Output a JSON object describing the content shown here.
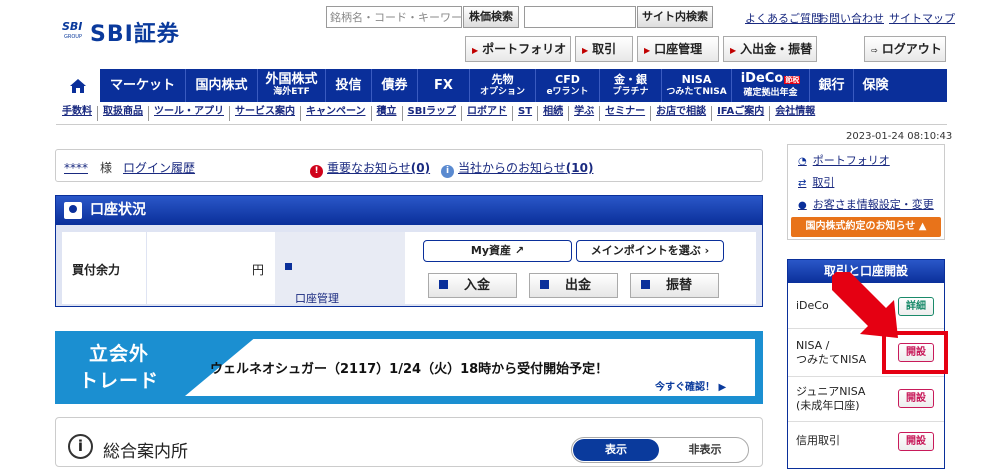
{
  "header": {
    "logo_mark": "SBI",
    "logo_group": "GROUP",
    "logo_text": "SBI証券",
    "stock_search_placeholder": "銘柄名・コード・キーワード",
    "stock_search_button": "株価検索",
    "site_search_value": "",
    "site_search_button": "サイト内検索",
    "links": [
      "よくあるご質問",
      "お問い合わせ",
      "サイトマップ"
    ],
    "buttons": {
      "portfolio": "ポートフォリオ",
      "trade": "取引",
      "account": "口座管理",
      "transfer": "入出金・振替",
      "logout": "ログアウト"
    }
  },
  "nav": {
    "home_icon": "home-icon",
    "items": [
      {
        "label": "マーケット",
        "sub": ""
      },
      {
        "label": "国内株式",
        "sub": ""
      },
      {
        "label": "外国株式",
        "sub": "海外ETF"
      },
      {
        "label": "投信",
        "sub": ""
      },
      {
        "label": "債券",
        "sub": ""
      },
      {
        "label": "FX",
        "sub": ""
      },
      {
        "label": "先物",
        "sub": "オプション"
      },
      {
        "label": "CFD",
        "sub": "eワラント"
      },
      {
        "label": "金・銀",
        "sub": "プラチナ"
      },
      {
        "label": "NISA",
        "sub": "つみたてNISA"
      },
      {
        "label": "iDeCo",
        "sub": "確定拠出年金",
        "badge": "節税"
      },
      {
        "label": "銀行",
        "sub": ""
      },
      {
        "label": "保険",
        "sub": ""
      }
    ]
  },
  "subnav": [
    "手数料",
    "取扱商品",
    "ツール・アプリ",
    "サービス案内",
    "キャンペーン",
    "積立",
    "SBIラップ",
    "ロボアド",
    "ST",
    "相続",
    "学ぶ",
    "セミナー",
    "お店で相談",
    "IFAご案内",
    "会社情報"
  ],
  "timestamp": "2023-01-24 08:10:43",
  "notice": {
    "user_masked": "****",
    "user_suffix": "様",
    "login_history": "ログイン履歴",
    "important_label": "重要なお知らせ",
    "important_count": "(0)",
    "company_label": "当社からのお知らせ",
    "company_count": "(10)"
  },
  "account": {
    "title": "口座状況",
    "buying_power_label": "買付余力",
    "buying_power_unit": "円",
    "account_mgmt_link": "口座管理",
    "my_assets": "My資産",
    "main_point": "メインポイントを選ぶ",
    "deposit": "入金",
    "withdraw": "出金",
    "transfer": "振替"
  },
  "banner": {
    "left_line1": "立会外",
    "left_line2": "トレード",
    "text": "ウェルネオシュガー（2117）1/24（火）18時から受付開始予定！",
    "link": "今すぐ確認！"
  },
  "general": {
    "title": "総合案内所",
    "show": "表示",
    "hide": "非表示"
  },
  "sidebar": {
    "links": [
      "ポートフォリオ",
      "取引",
      "お客さま情報設定・変更"
    ],
    "domestic_notice": "国内株式約定のお知らせ",
    "panel_title": "取引と口座開設",
    "rows": [
      {
        "name": "iDeCo",
        "button": "詳細",
        "style": "green"
      },
      {
        "name": "NISA /\nつみたてNISA",
        "button": "開設",
        "style": "pink"
      },
      {
        "name": "ジュニアNISA\n(未成年口座)",
        "button": "開設",
        "style": "pink"
      },
      {
        "name": "信用取引",
        "button": "開設",
        "style": "pink"
      }
    ]
  },
  "colors": {
    "brand_blue": "#0a2f9a",
    "banner_blue": "#1b8fd1",
    "orange": "#e8731a",
    "highlight_red": "#e50012"
  }
}
